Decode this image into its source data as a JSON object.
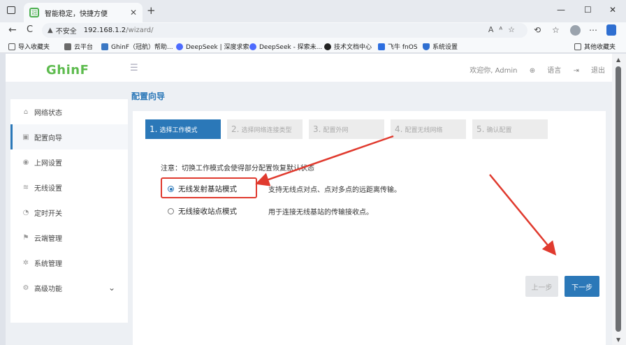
{
  "browser": {
    "tab_title": "智能稳定，快捷方便",
    "tab_favicon": "冠",
    "tab_close": "✕",
    "new_tab": "+",
    "window_controls": [
      "—",
      "☐",
      "✕"
    ],
    "nav_back": "←",
    "nav_refresh": "C",
    "insecure_label": "不安全",
    "url_host": "192.168.1.2",
    "url_path": "/wizard/",
    "addr_icons": "Aᴬ☆",
    "bookmarks": [
      {
        "label": "导入收藏夹",
        "color": "#555555"
      },
      {
        "label": "云平台",
        "color": "#6a6a6a"
      },
      {
        "label": "GhinF（冠航）帮助...",
        "color": "#3b78c4"
      },
      {
        "label": "DeepSeek | 深度求索",
        "color": "#4d6bfe"
      },
      {
        "label": "DeepSeek - 探索未...",
        "color": "#4d6bfe"
      },
      {
        "label": "技术文档中心",
        "color": "#222222"
      },
      {
        "label": "飞牛 fnOS",
        "color": "#2c6ee0"
      },
      {
        "label": "系统设置",
        "color": "#2f6fd1"
      }
    ],
    "other_bookmarks": "其他收藏夹"
  },
  "header": {
    "logo_a": "Ghin",
    "logo_b": "F",
    "welcome": "欢迎你, Admin",
    "language": "语言",
    "logout": "退出"
  },
  "sidebar": {
    "items": [
      {
        "label": "网络状态",
        "icon": "⌂"
      },
      {
        "label": "配置向导",
        "icon": "▣"
      },
      {
        "label": "上网设置",
        "icon": "◉"
      },
      {
        "label": "无线设置",
        "icon": "≋"
      },
      {
        "label": "定时开关",
        "icon": "◔"
      },
      {
        "label": "云端管理",
        "icon": "⚑"
      },
      {
        "label": "系统管理",
        "icon": "✲"
      },
      {
        "label": "高级功能",
        "icon": "⚙"
      }
    ],
    "expand_icon": "⌄"
  },
  "main": {
    "breadcrumb": "配置向导",
    "steps": [
      {
        "num": "1.",
        "label": "选择工作模式"
      },
      {
        "num": "2.",
        "label": "选择网络连接类型"
      },
      {
        "num": "3.",
        "label": "配置外网"
      },
      {
        "num": "4.",
        "label": "配置无线网络"
      },
      {
        "num": "5.",
        "label": "确认配置"
      }
    ],
    "notice": "注意：切换工作模式会使得部分配置恢复默认状态",
    "options": [
      {
        "label": "无线发射基站模式",
        "desc": "支持无线点对点、点对多点的远距离传输。",
        "selected": true
      },
      {
        "label": "无线接收站点模式",
        "desc": "用于连接无线基站的传输接收点。",
        "selected": false
      }
    ],
    "prev_button": "上一步",
    "next_button": "下一步"
  },
  "colors": {
    "accent": "#2b78b8",
    "annotation": "#e03a2e",
    "logo_green": "#5dbb4e"
  }
}
